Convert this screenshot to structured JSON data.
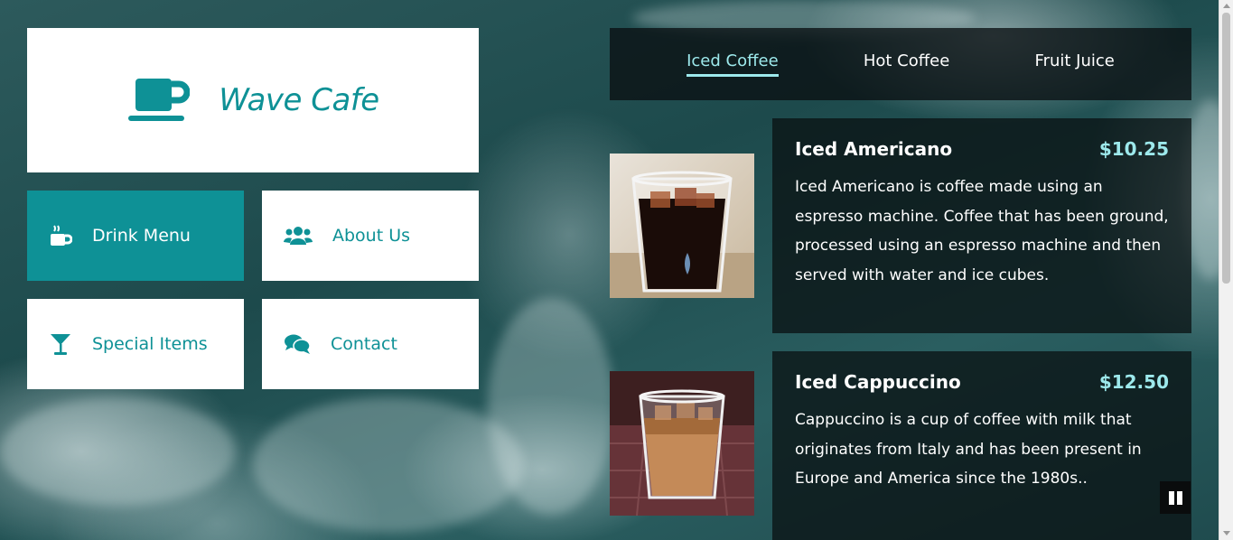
{
  "logo": {
    "brand": "Wave Cafe",
    "icon": "coffee-cup-icon"
  },
  "nav": {
    "drink_menu": {
      "label": "Drink Menu",
      "icon": "mug-hot-icon"
    },
    "about_us": {
      "label": "About Us",
      "icon": "users-icon"
    },
    "special_items": {
      "label": "Special Items",
      "icon": "cocktail-glass-icon"
    },
    "contact": {
      "label": "Contact",
      "icon": "chat-bubbles-icon"
    }
  },
  "tabs": [
    "Iced Coffee",
    "Hot Coffee",
    "Fruit Juice"
  ],
  "active_tab": "Iced Coffee",
  "items": [
    {
      "name": "Iced Americano",
      "price": "$10.25",
      "description": "Iced Americano is coffee made using an espresso machine. Coffee that has been ground, processed using an espresso machine and then served with water and ice cubes."
    },
    {
      "name": "Iced Cappuccino",
      "price": "$12.50",
      "description": "Cappuccino is a cup of coffee with milk that originates from Italy and has been present in Europe and America since the 1980s.."
    }
  ],
  "colors": {
    "accent": "#0e9196",
    "price": "#9de9ec",
    "panel": "#0a1012"
  }
}
